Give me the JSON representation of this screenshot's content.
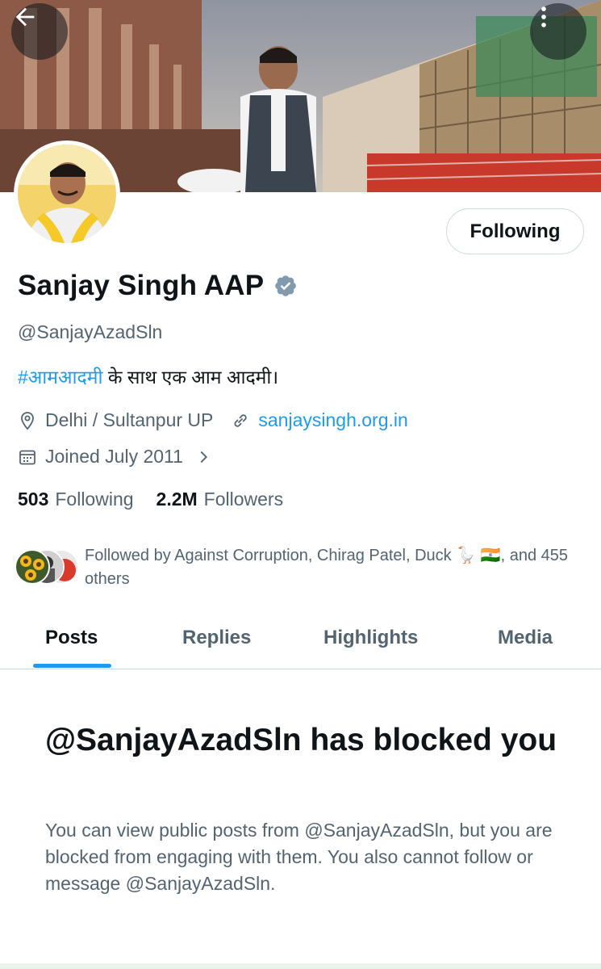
{
  "header": {
    "back_icon": "arrow-left-icon",
    "more_icon": "more-vertical-icon"
  },
  "profile": {
    "display_name": "Sanjay Singh AAP",
    "verified_icon": "verified-badge-icon",
    "handle": "@SanjayAzadSln",
    "bio_hashtag": "#आमआदमी",
    "bio_text": " के साथ एक आम आदमी।",
    "location": "Delhi / Sultanpur UP",
    "website": "sanjaysingh.org.in",
    "joined": "Joined July 2011",
    "follow_button_label": "Following"
  },
  "stats": {
    "following_count": "503",
    "following_label": "Following",
    "followers_count": "2.2M",
    "followers_label": "Followers"
  },
  "followed_by": {
    "text": "Followed by Against Corruption, Chirag Patel, Duck 🪿 🇮🇳, and 455 others"
  },
  "tabs": [
    {
      "label": "Posts",
      "active": true
    },
    {
      "label": "Replies",
      "active": false
    },
    {
      "label": "Highlights",
      "active": false
    },
    {
      "label": "Media",
      "active": false
    }
  ],
  "blocked": {
    "title": "@SanjayAzadSln has blocked you",
    "body": "You can view public posts from @SanjayAzadSln, but you are blocked from engaging with them. You also cannot follow or message @SanjayAzadSln."
  },
  "colors": {
    "accent": "#1d9bf0",
    "text_primary": "#0f1419",
    "text_secondary": "#536471",
    "border": "#cfd9de"
  }
}
